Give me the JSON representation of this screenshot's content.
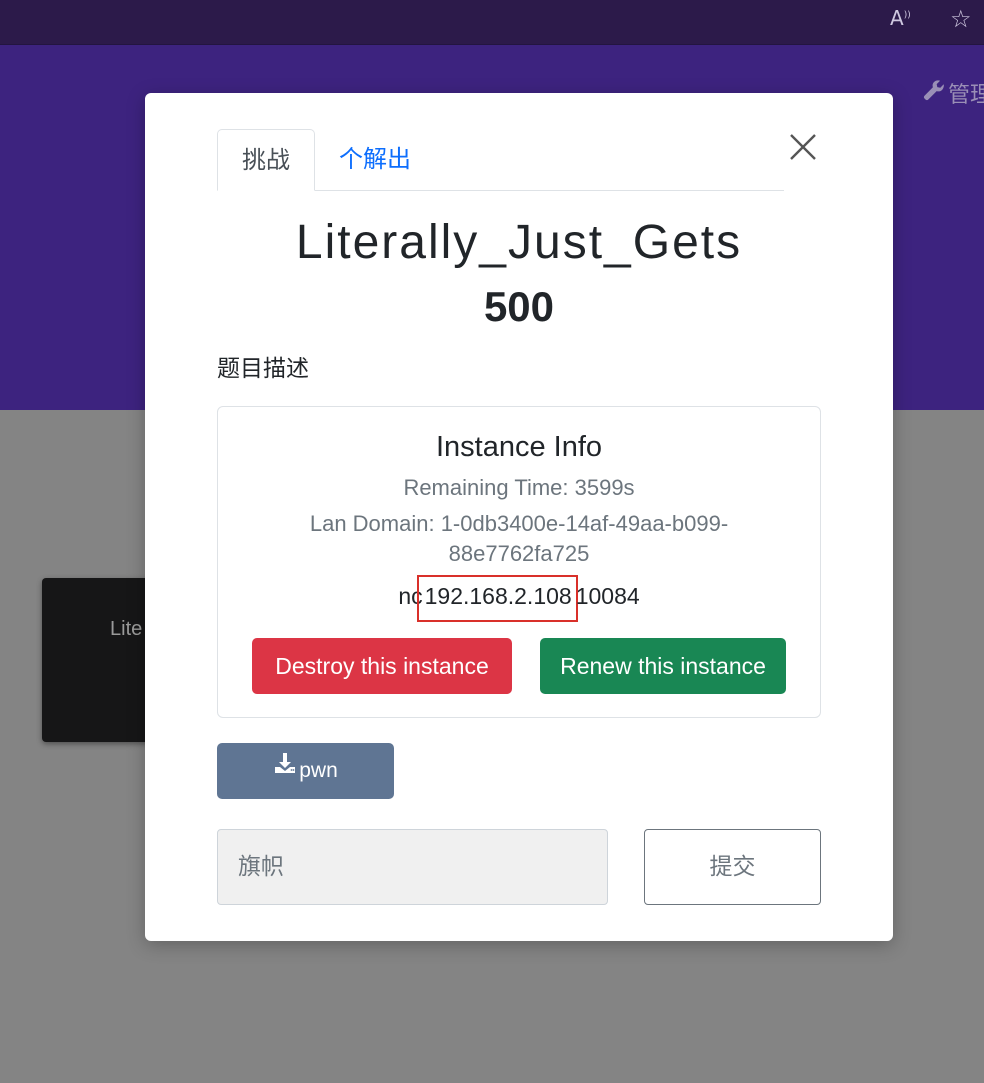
{
  "browser": {
    "read_aloud_icon": "read-aloud-icon",
    "favorite_icon": "star-icon"
  },
  "header": {
    "admin_label": "管理",
    "admin_icon": "wrench-icon"
  },
  "background_card": {
    "name_partial": "Lite"
  },
  "modal": {
    "tabs": [
      {
        "label": "挑战",
        "active": true
      },
      {
        "label": "个解出",
        "active": false
      }
    ],
    "close_icon": "close-icon",
    "challenge_name": "Literally_Just_Gets",
    "challenge_value": "500",
    "description_label": "题目描述",
    "instance": {
      "title": "Instance Info",
      "remaining_time": "Remaining Time: 3599s",
      "lan_domain": "Lan Domain: 1-0db3400e-14af-49aa-b099-88e7762fa725",
      "nc_prefix": "nc",
      "ip": "192.168.2.108",
      "port": "10084",
      "destroy_label": "Destroy this instance",
      "renew_label": "Renew this instance"
    },
    "download": {
      "label": "pwn",
      "icon": "download-icon"
    },
    "flag_input": {
      "placeholder": "旗帜",
      "value": ""
    },
    "submit_label": "提交"
  },
  "colors": {
    "browser_bar": "#2c1a4a",
    "jumbotron": "#3d237f",
    "overlay_gray": "#848484",
    "danger": "#dc3545",
    "success": "#198754",
    "download_button": "#5f7593",
    "link_blue": "#0d6efd",
    "highlight_red": "#d9302a"
  }
}
